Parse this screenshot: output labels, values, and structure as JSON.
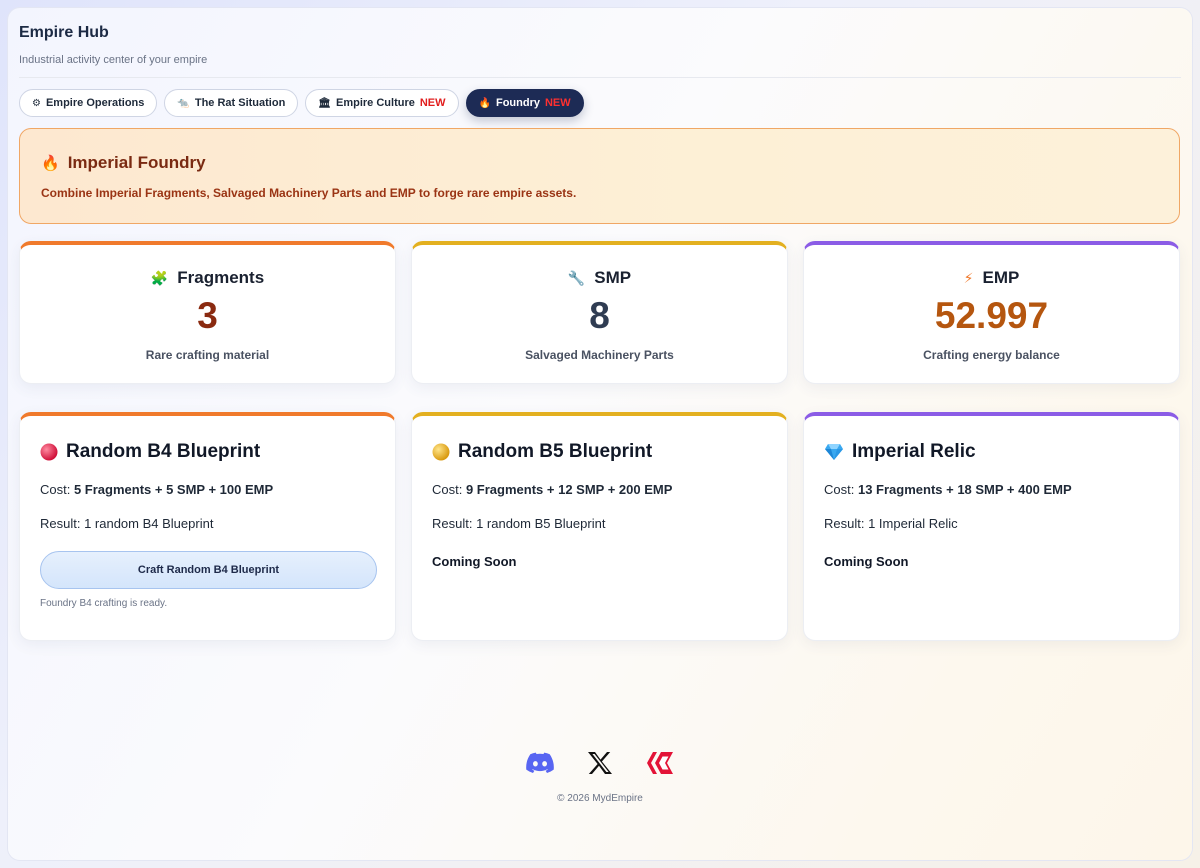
{
  "app": {
    "title": "Empire Hub",
    "subtitle": "Industrial activity center of your empire"
  },
  "tabs": [
    {
      "icon": "gear-icon",
      "glyph": "⚙",
      "label": "Empire Operations",
      "badge": ""
    },
    {
      "icon": "rat-icon",
      "glyph": "🐀",
      "label": "The Rat Situation",
      "badge": ""
    },
    {
      "icon": "museum-icon",
      "glyph": "🏛",
      "label": "Empire Culture",
      "badge": "NEW"
    },
    {
      "icon": "fire-icon",
      "glyph": "🔥",
      "label": "Foundry",
      "badge": "NEW",
      "active": true
    }
  ],
  "banner": {
    "icon": "fire-icon",
    "glyph": "🔥",
    "title": "Imperial Foundry",
    "description": "Combine Imperial Fragments, Salvaged Machinery Parts and EMP to forge rare empire assets."
  },
  "stats": [
    {
      "icon": "puzzle-icon",
      "glyph": "🧩",
      "label": "Fragments",
      "value": "3",
      "caption": "Rare crafting material",
      "accent": "#f07a2c",
      "value_color": "#8a2a10"
    },
    {
      "icon": "wrench-icon",
      "glyph": "🔧",
      "label": "SMP",
      "value": "8",
      "caption": "Salvaged Machinery Parts",
      "accent": "#e3b020",
      "value_color": "#2f3c52"
    },
    {
      "icon": "lightning-icon",
      "glyph": "⚡",
      "label": "EMP",
      "value": "52.997",
      "caption": "Crafting energy balance",
      "accent": "#8b5ce6",
      "value_color": "#b5560f"
    }
  ],
  "recipes": [
    {
      "icon": "red-orb-icon",
      "title": "Random B4 Blueprint",
      "cost_label": "Cost:",
      "cost": "5 Fragments + 5 SMP + 100 EMP",
      "result": "Result: 1 random B4 Blueprint",
      "button": "Craft Random B4 Blueprint",
      "note": "Foundry B4 crafting is ready.",
      "status": "",
      "accent": "#f07a2c"
    },
    {
      "icon": "gold-orb-icon",
      "title": "Random B5 Blueprint",
      "cost_label": "Cost:",
      "cost": "9 Fragments + 12 SMP + 200 EMP",
      "result": "Result: 1 random B5 Blueprint",
      "button": "",
      "note": "",
      "status": "Coming Soon",
      "accent": "#e3b020"
    },
    {
      "icon": "gem-icon",
      "title": "Imperial Relic",
      "cost_label": "Cost:",
      "cost": "13 Fragments + 18 SMP + 400 EMP",
      "result": "Result: 1 Imperial Relic",
      "button": "",
      "note": "",
      "status": "Coming Soon",
      "accent": "#8b5ce6"
    }
  ],
  "footer": {
    "socials": [
      "discord-icon",
      "x-icon",
      "hive-icon"
    ],
    "copyright": "© 2026 MydEmpire"
  }
}
